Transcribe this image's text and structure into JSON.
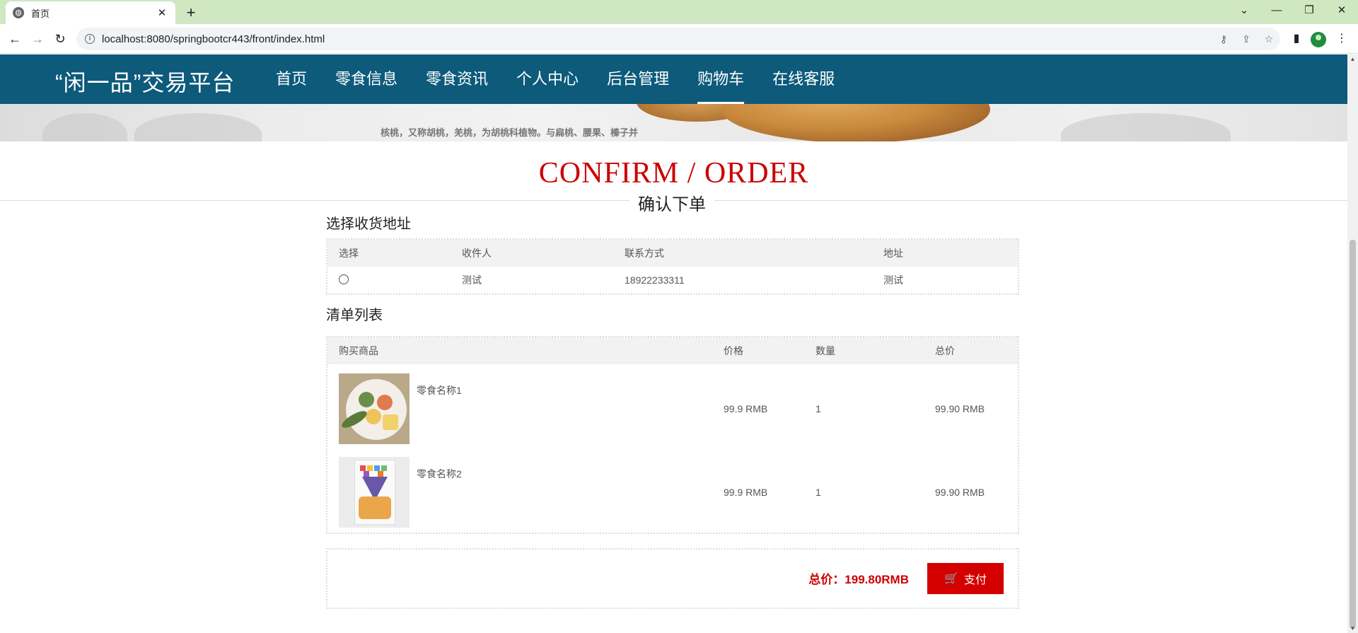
{
  "browser": {
    "tab_title": "首页",
    "url": "localhost:8080/springbootcr443/front/index.html"
  },
  "site": {
    "logo": "“闲一品”交易平台",
    "nav": [
      "首页",
      "零食信息",
      "零食资讯",
      "个人中心",
      "后台管理",
      "购物车",
      "在线客服"
    ],
    "active_nav": "购物车",
    "banner_caption": "核桃，又称胡桃，羌桃，为胡桃科植物。与扁桃、腰果、榛子并"
  },
  "section": {
    "title": "CONFIRM / ORDER",
    "subtitle": "确认下单"
  },
  "address": {
    "heading": "选择收货地址",
    "columns": [
      "选择",
      "收件人",
      "联系方式",
      "地址"
    ],
    "rows": [
      {
        "recipient": "测试",
        "phone": "18922233311",
        "address": "测试",
        "selected": false
      }
    ]
  },
  "order": {
    "heading": "清单列表",
    "columns": [
      "购买商品",
      "价格",
      "数量",
      "总价"
    ],
    "items": [
      {
        "name": "零食名称1",
        "price": "99.9 RMB",
        "qty": "1",
        "subtotal": "99.90 RMB"
      },
      {
        "name": "零食名称2",
        "price": "99.9 RMB",
        "qty": "1",
        "subtotal": "99.90 RMB"
      }
    ]
  },
  "summary": {
    "total": "总价：199.80RMB",
    "pay_label": "支付"
  },
  "colors": {
    "header_bg": "#0d5a7a",
    "accent_red": "#d40000",
    "title_red": "#cc0000"
  }
}
